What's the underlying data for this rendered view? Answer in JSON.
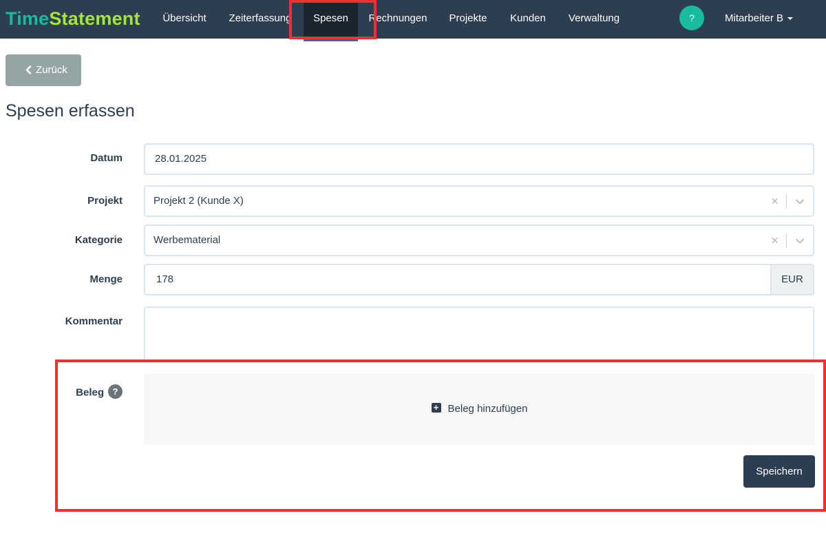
{
  "brand": {
    "part1": "Time",
    "part2": "Statement"
  },
  "nav": {
    "items": [
      {
        "label": "Übersicht"
      },
      {
        "label": "Zeiterfassung"
      },
      {
        "label": "Spesen"
      },
      {
        "label": "Rechnungen"
      },
      {
        "label": "Projekte"
      },
      {
        "label": "Kunden"
      },
      {
        "label": "Verwaltung"
      }
    ],
    "active": "Spesen",
    "help_label": "?",
    "user_label": "Mitarbeiter B"
  },
  "back_button": {
    "label": "Zurück"
  },
  "page_title": "Spesen erfassen",
  "form": {
    "datum": {
      "label": "Datum",
      "value": "28.01.2025"
    },
    "projekt": {
      "label": "Projekt",
      "value": "Projekt 2 (Kunde X)",
      "clear": "×"
    },
    "kategorie": {
      "label": "Kategorie",
      "value": "Werbematerial",
      "clear": "×"
    },
    "menge": {
      "label": "Menge",
      "value": "178",
      "unit": "EUR"
    },
    "kommentar": {
      "label": "Kommentar",
      "value": ""
    },
    "beleg": {
      "label": "Beleg",
      "help": "?",
      "add_label": "Beleg hinzufügen",
      "add_icon": "+"
    },
    "save_label": "Speichern"
  },
  "colors": {
    "navbar": "#2c3e50",
    "brand_primary": "#18bc9c",
    "brand_secondary": "#a3e635",
    "highlight": "#ee3030",
    "back_button": "#95a5a6"
  }
}
